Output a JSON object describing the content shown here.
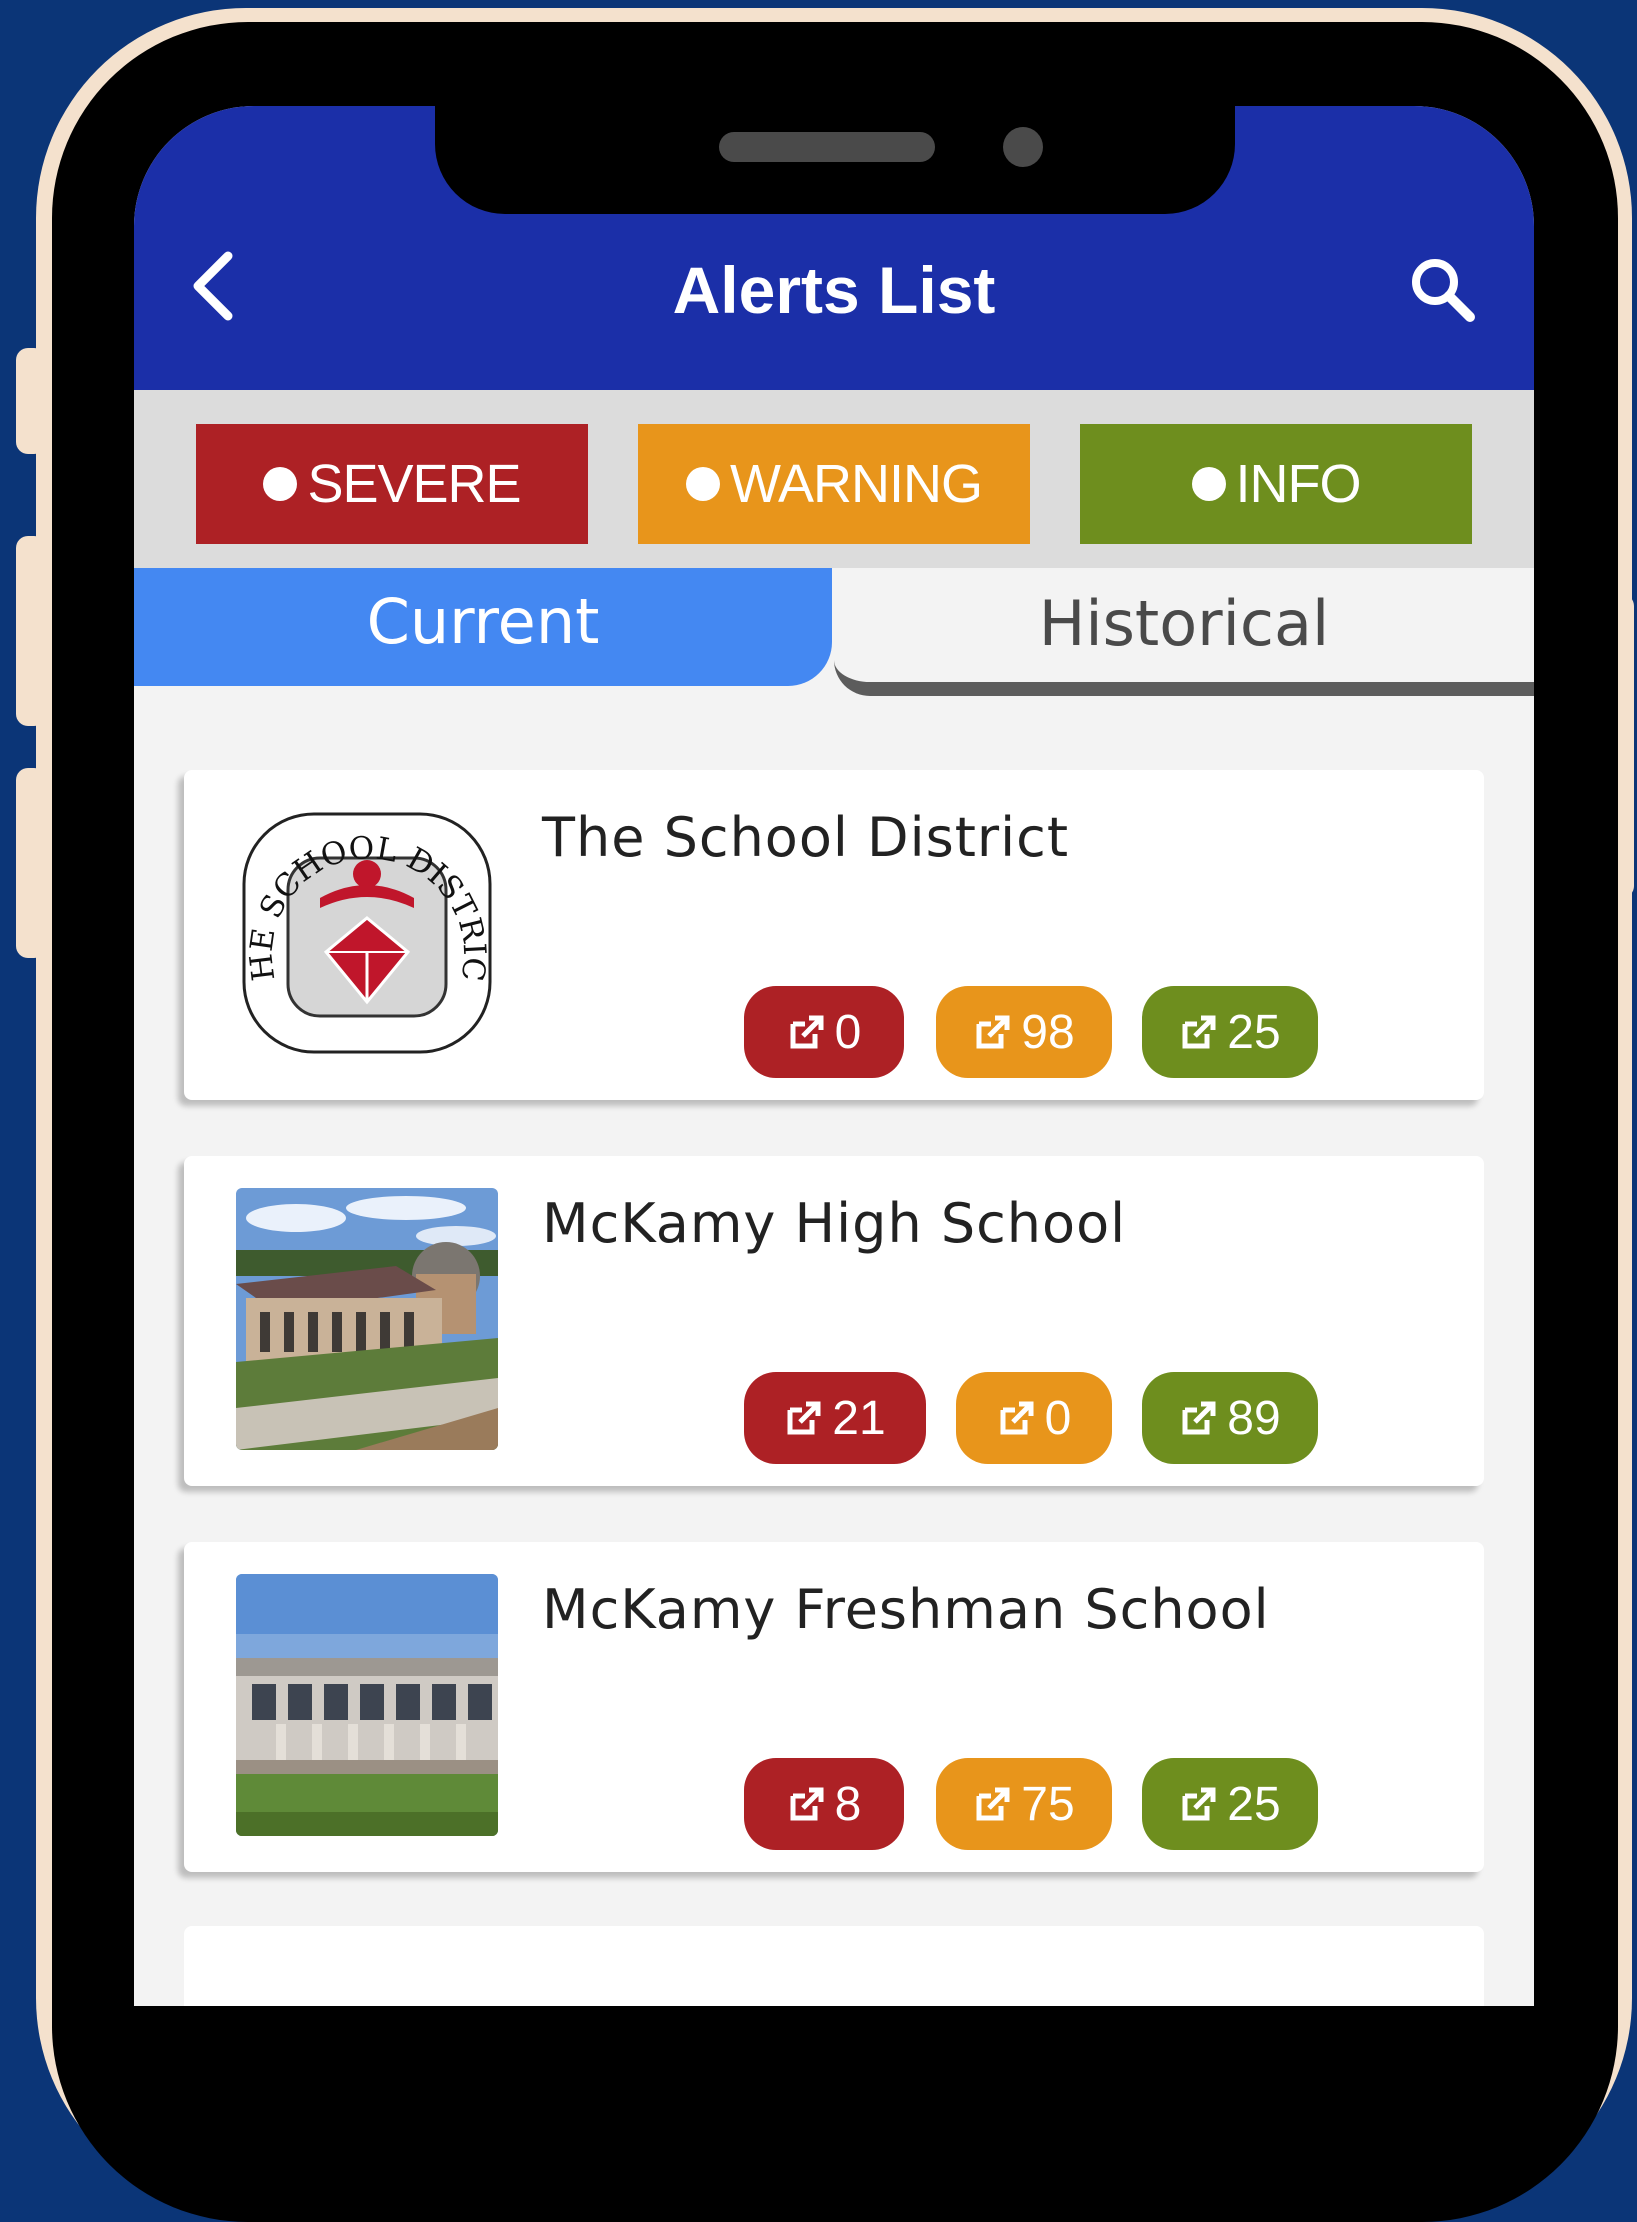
{
  "header": {
    "title": "Alerts List"
  },
  "filters": [
    {
      "label": "SEVERE",
      "color": "#ad2125"
    },
    {
      "label": "WARNING",
      "color": "#e8951b"
    },
    {
      "label": "INFO",
      "color": "#6e8e1e"
    }
  ],
  "tabs": {
    "current": "Current",
    "historical": "Historical"
  },
  "schools": [
    {
      "name": "The School District",
      "image": "district-logo",
      "counts": {
        "severe": "0",
        "warning": "98",
        "info": "25"
      }
    },
    {
      "name": "McKamy High School",
      "image": "building-photo",
      "counts": {
        "severe": "21",
        "warning": "0",
        "info": "89"
      }
    },
    {
      "name": "McKamy Freshman School",
      "image": "building-photo",
      "counts": {
        "severe": "8",
        "warning": "75",
        "info": "25"
      }
    }
  ],
  "logo": {
    "text": "THE SCHOOL DISTRICT"
  },
  "icons": {
    "back": "chevron-left-icon",
    "search": "search-icon",
    "badge": "external-link-icon"
  }
}
